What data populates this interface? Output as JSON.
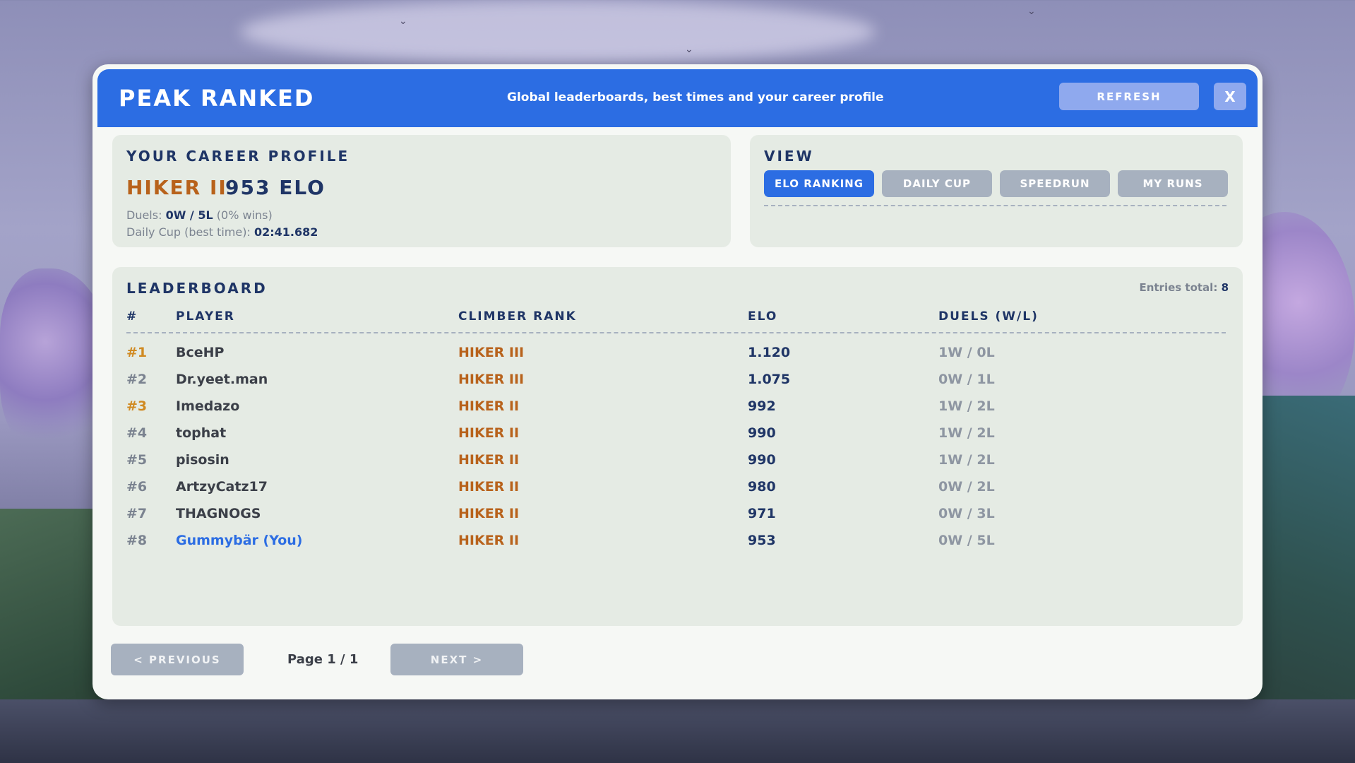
{
  "app": {
    "title": "PEAK RANKED",
    "subtitle": "Global leaderboards, best times and your career profile",
    "refresh_label": "REFRESH",
    "close_label": "X"
  },
  "career": {
    "title": "YOUR CAREER PROFILE",
    "rank": "HIKER II",
    "elo": "953 ELO",
    "duels_label": "Duels:",
    "duels_value": "0W / 5L",
    "duels_pct": "(0% wins)",
    "daily_label": "Daily Cup (best time):",
    "daily_value": "02:41.682"
  },
  "view": {
    "title": "VIEW",
    "tabs": [
      {
        "label": "ELO RANKING",
        "active": true
      },
      {
        "label": "DAILY CUP",
        "active": false
      },
      {
        "label": "SPEEDRUN",
        "active": false
      },
      {
        "label": "MY RUNS",
        "active": false
      }
    ]
  },
  "leaderboard": {
    "title": "LEADERBOARD",
    "entries_label": "Entries total:",
    "entries_count": "8",
    "columns": [
      "#",
      "PLAYER",
      "CLIMBER RANK",
      "ELO",
      "DUELS (W/L)"
    ],
    "rows": [
      {
        "num": "#1",
        "player": "BceHP",
        "rank": "HIKER III",
        "elo": "1.120",
        "duels": "1W / 0L"
      },
      {
        "num": "#2",
        "player": "Dr.yeet.man",
        "rank": "HIKER III",
        "elo": "1.075",
        "duels": "0W / 1L"
      },
      {
        "num": "#3",
        "player": "Imedazo",
        "rank": "HIKER II",
        "elo": "992",
        "duels": "1W / 2L"
      },
      {
        "num": "#4",
        "player": "tophat",
        "rank": "HIKER II",
        "elo": "990",
        "duels": "1W / 2L"
      },
      {
        "num": "#5",
        "player": "pisosin",
        "rank": "HIKER II",
        "elo": "990",
        "duels": "1W / 2L"
      },
      {
        "num": "#6",
        "player": "ArtzyCatz17",
        "rank": "HIKER II",
        "elo": "980",
        "duels": "0W / 2L"
      },
      {
        "num": "#7",
        "player": "THAGNOGS",
        "rank": "HIKER II",
        "elo": "971",
        "duels": "0W / 3L"
      },
      {
        "num": "#8",
        "player": "Gummybär (You)",
        "rank": "HIKER II",
        "elo": "953",
        "duels": "0W / 5L"
      }
    ]
  },
  "pagination": {
    "prev_label": "< PREVIOUS",
    "page_label": "Page 1 / 1",
    "next_label": "NEXT >"
  },
  "colors": {
    "accent": "#2c6de3",
    "rank": "#b8621b",
    "top_place": "#d08a22",
    "text_dark": "#1f3566"
  }
}
